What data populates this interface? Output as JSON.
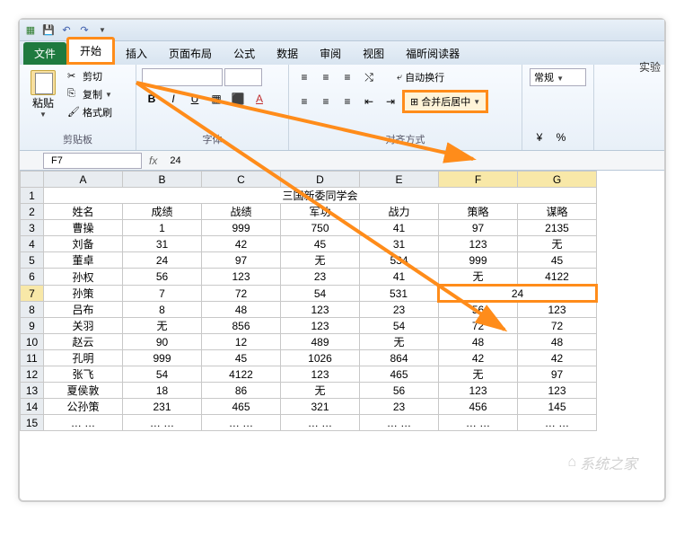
{
  "qat": {
    "save_tip": "保存",
    "undo_tip": "撤销",
    "redo_tip": "恢复"
  },
  "trimmed_label": "实验",
  "tabs": {
    "file": "文件",
    "home": "开始",
    "insert": "插入",
    "layout": "页面布局",
    "formulas": "公式",
    "data": "数据",
    "review": "审阅",
    "view": "视图",
    "foxit": "福昕阅读器"
  },
  "clipboard": {
    "paste": "粘贴",
    "cut": "剪切",
    "copy": "复制",
    "format": "格式刷",
    "group": "剪贴板"
  },
  "font": {
    "bold": "B",
    "italic": "I",
    "underline": "U",
    "group": "字体"
  },
  "alignment": {
    "wrap": "自动换行",
    "merge": "合并后居中",
    "group": "对齐方式"
  },
  "number": {
    "general": "常规"
  },
  "name_box": "F7",
  "formula_value": "24",
  "columns": [
    "A",
    "B",
    "C",
    "D",
    "E",
    "F",
    "G"
  ],
  "selected_cols": [
    "F",
    "G"
  ],
  "selected_row": 7,
  "chart_data": {
    "type": "table",
    "title": "三国新委同学会",
    "headers": [
      "姓名",
      "成绩",
      "战绩",
      "军功",
      "战力",
      "策略",
      "谋略"
    ],
    "rows": [
      [
        "曹操",
        "1",
        "999",
        "750",
        "41",
        "97",
        "2135"
      ],
      [
        "刘备",
        "31",
        "42",
        "45",
        "31",
        "123",
        "无"
      ],
      [
        "董卓",
        "24",
        "97",
        "无",
        "534",
        "999",
        "45"
      ],
      [
        "孙权",
        "56",
        "123",
        "23",
        "41",
        "无",
        "4122"
      ],
      [
        "孙策",
        "7",
        "72",
        "54",
        "531",
        "24",
        ""
      ],
      [
        "吕布",
        "8",
        "48",
        "123",
        "23",
        "56",
        "123"
      ],
      [
        "关羽",
        "无",
        "856",
        "123",
        "54",
        "72",
        "72"
      ],
      [
        "赵云",
        "90",
        "12",
        "489",
        "无",
        "48",
        "48"
      ],
      [
        "孔明",
        "999",
        "45",
        "1026",
        "864",
        "42",
        "42"
      ],
      [
        "张飞",
        "54",
        "4122",
        "123",
        "465",
        "无",
        "97"
      ],
      [
        "夏侯敦",
        "18",
        "86",
        "无",
        "56",
        "123",
        "123"
      ],
      [
        "公孙策",
        "231",
        "465",
        "321",
        "23",
        "456",
        "145"
      ],
      [
        "…  …",
        "…  …",
        "…  …",
        "…  …",
        "…  …",
        "…  …",
        "…  …"
      ]
    ],
    "merged": {
      "row_index": 4,
      "col_start": 5,
      "col_span": 2,
      "value": "24"
    }
  },
  "watermark": "系统之家"
}
